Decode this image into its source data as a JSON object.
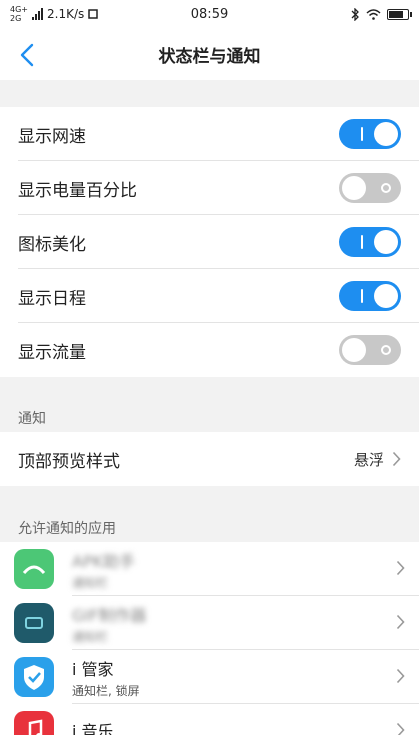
{
  "status_bar": {
    "network_type": "4G+",
    "network_type_2": "2G",
    "speed": "2.1K/s",
    "time": "08:59"
  },
  "header": {
    "title": "状态栏与通知"
  },
  "toggles": [
    {
      "label": "显示网速",
      "on": true
    },
    {
      "label": "显示电量百分比",
      "on": false
    },
    {
      "label": "图标美化",
      "on": true
    },
    {
      "label": "显示日程",
      "on": true
    },
    {
      "label": "显示流量",
      "on": false
    }
  ],
  "notify_section": {
    "label": "通知",
    "preview_style_label": "顶部预览样式",
    "preview_style_value": "悬浮"
  },
  "apps_section": {
    "label": "允许通知的应用",
    "apps": [
      {
        "name": "APK助手",
        "sub": "通知栏",
        "icon": "apk-helper-icon",
        "color": "#4cc776"
      },
      {
        "name": "GIF制作器",
        "sub": "通知栏",
        "icon": "gif-maker-icon",
        "color": "#1f5a6a"
      },
      {
        "name": "i 管家",
        "sub": "通知栏, 锁屏",
        "icon": "shield-icon",
        "color": "#2aa0ea"
      },
      {
        "name": "i 音乐",
        "sub": "",
        "icon": "music-icon",
        "color": "#e8323c"
      }
    ]
  },
  "colors": {
    "accent": "#1e8ef0",
    "toggle_off": "#c8c8c8",
    "background": "#f2f2f2"
  }
}
